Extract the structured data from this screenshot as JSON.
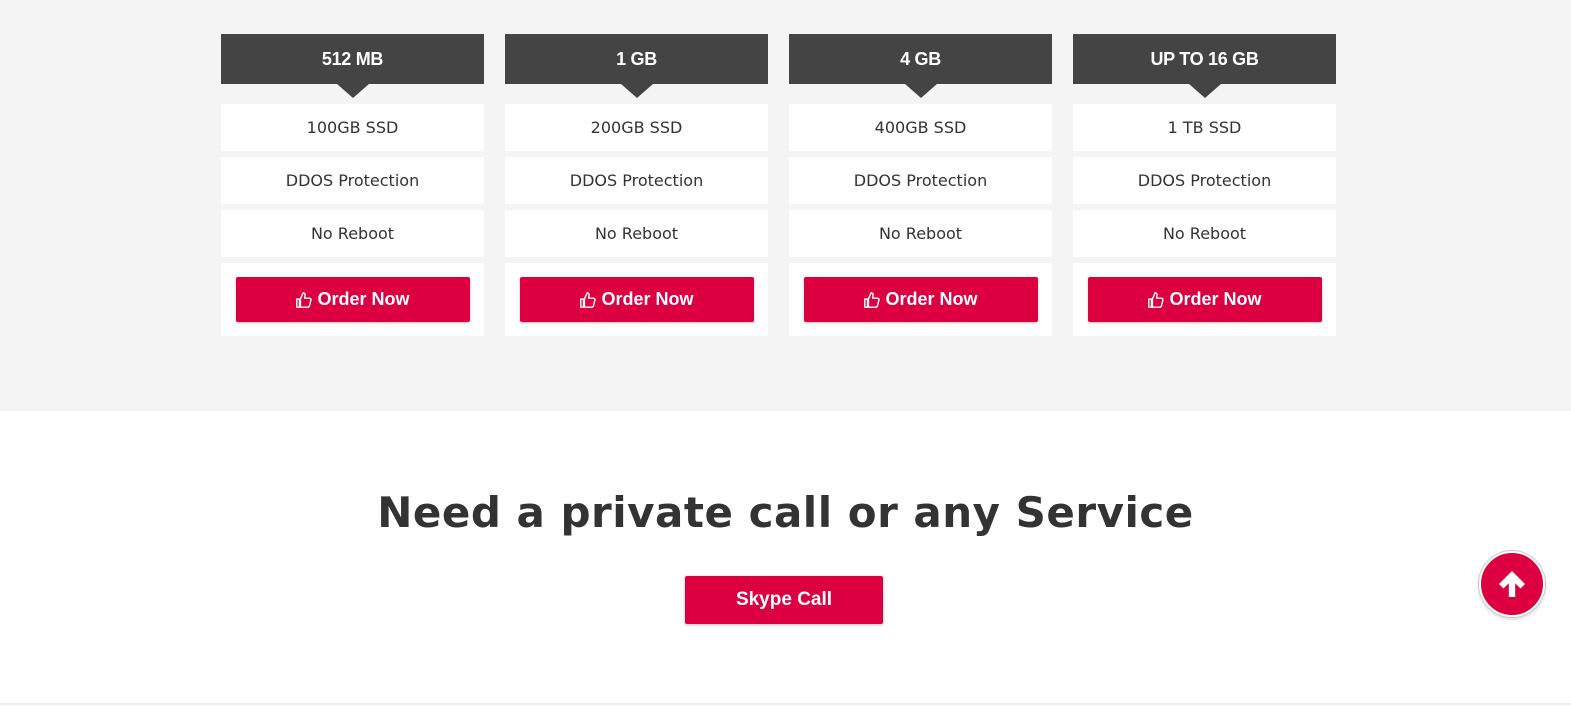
{
  "plans": [
    {
      "title": "512 MB",
      "features": [
        "100GB SSD",
        "DDOS Protection",
        "No Reboot"
      ],
      "button": "Order Now"
    },
    {
      "title": "1 GB",
      "features": [
        "200GB SSD",
        "DDOS Protection",
        "No Reboot"
      ],
      "button": "Order Now"
    },
    {
      "title": "4 GB",
      "features": [
        "400GB SSD",
        "DDOS Protection",
        "No Reboot"
      ],
      "button": "Order Now"
    },
    {
      "title": "UP TO 16 GB",
      "features": [
        "1 TB SSD",
        "DDOS Protection",
        "No Reboot"
      ],
      "button": "Order Now"
    }
  ],
  "cta": {
    "title": "Need a private call or any Service",
    "button": "Skype Call"
  },
  "icons": {
    "order": "thumbs-up-icon",
    "scroll": "arrow-up-icon"
  },
  "colors": {
    "accent": "#dc0041",
    "header": "#444444",
    "section_bg": "#f4f4f4"
  }
}
